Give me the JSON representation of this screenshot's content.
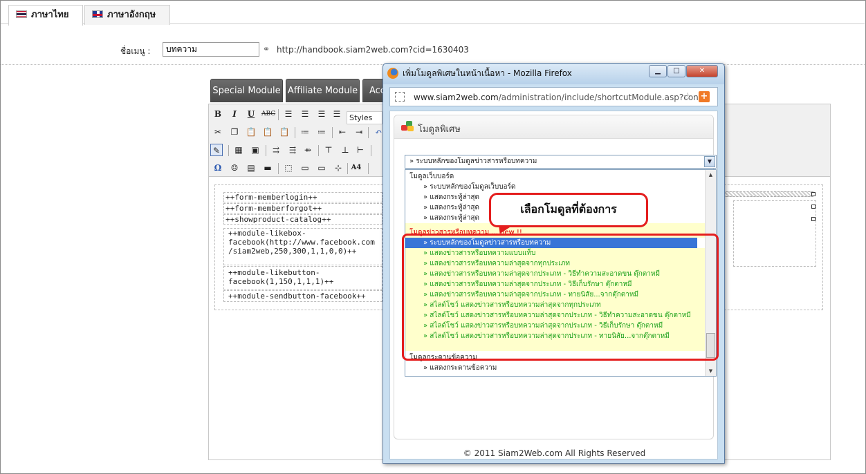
{
  "language_tabs": [
    {
      "label": "ภาษาไทย",
      "flag": "thai-flag"
    },
    {
      "label": "ภาษาอังกฤษ",
      "flag": "uk-flag"
    }
  ],
  "menu": {
    "label": "ชื่อเมนู :",
    "value": "บทความ",
    "url": "http://handbook.siam2web.com?cid=1630403"
  },
  "module_buttons": [
    "Special Module",
    "Affiliate Module",
    "Acc"
  ],
  "editor": {
    "styles_label": "Styles",
    "content_lines": [
      "++form-memberlogin++",
      "++form-memberforgot++",
      "++showproduct-catalog++",
      "++module-likebox-",
      "facebook(http://www.facebook.com",
      "/siam2web,250,300,1,1,0,0)++",
      "++module-likebutton-",
      "facebook(1,150,1,1,1)++",
      "++module-sendbutton-facebook++"
    ]
  },
  "popup": {
    "title": "เพิ่มโมดูลพิเศษในหน้าเนื้อหา - Mozilla Firefox",
    "url_host": "www.siam2web.com",
    "url_path": "/administration/include/shortcutModule.asp?conte",
    "panel_title": "โมดูลพิเศษ",
    "select_value": "» ระบบหลักของโมดูลข่าวสารหรือบทความ",
    "list": [
      {
        "text": "โมดูลเว็บบอร์ด",
        "kind": "grp"
      },
      {
        "text": "» ระบบหลักของโมดูลเว็บบอร์ด",
        "kind": "sub"
      },
      {
        "text": "» แสดงกระทู้ล่าสุด",
        "kind": "sub"
      },
      {
        "text": "» แสดงกระทู้ล่าสุด",
        "kind": "sub"
      },
      {
        "text": "» แสดงกระทู้ล่าสุด",
        "kind": "sub"
      },
      {
        "text": "โมดูลข่าวสารหรือบทความ ... new !!",
        "kind": "grp red hl"
      },
      {
        "text": "» ระบบหลักของโมดูลข่าวสารหรือบทความ",
        "kind": "sub selected"
      },
      {
        "text": "» แสดงข่าวสารหรือบทความแบบแท็บ",
        "kind": "sub green hl"
      },
      {
        "text": "» แสดงข่าวสารหรือบทความล่าสุดจากทุกประเภท",
        "kind": "sub green hl"
      },
      {
        "text": "» แสดงข่าวสารหรือบทความล่าสุดจากประเภท - วิธีทำความสะอาดขน ตุ๊กตาหมี",
        "kind": "sub green hl"
      },
      {
        "text": "» แสดงข่าวสารหรือบทความล่าสุดจากประเภท - วิธีเก็บรักษา ตุ๊กตาหมี",
        "kind": "sub green hl"
      },
      {
        "text": "» แสดงข่าวสารหรือบทความล่าสุดจากประเภท - ทายนิสัย...จากตุ๊กตาหมี",
        "kind": "sub green hl"
      },
      {
        "text": "» สไลด์โชว์ แสดงข่าวสารหรือบทความล่าสุดจากทุกประเภท",
        "kind": "sub green hl"
      },
      {
        "text": "» สไลด์โชว์ แสดงข่าวสารหรือบทความล่าสุดจากประเภท - วิธีทำความสะอาดขน ตุ๊กตาหมี",
        "kind": "sub green hl"
      },
      {
        "text": "» สไลด์โชว์ แสดงข่าวสารหรือบทความล่าสุดจากประเภท - วิธีเก็บรักษา ตุ๊กตาหมี",
        "kind": "sub green hl"
      },
      {
        "text": "» สไลด์โชว์ แสดงข่าวสารหรือบทความล่าสุดจากประเภท - ทายนิสัย...จากตุ๊กตาหมี",
        "kind": "sub green hl"
      },
      {
        "text": "",
        "kind": "grp hl"
      },
      {
        "text": "โมดูลกระดานข้อความ",
        "kind": "grp"
      },
      {
        "text": "» แสดงกระดานข้อความ",
        "kind": "sub"
      }
    ],
    "callout": "เลือกโมดูลที่ต้องการ",
    "footer": "© 2011 Siam2Web.com All Rights Reserved"
  },
  "colors": {
    "highlight_frame": "#e41e1e",
    "selected_row": "#3875d7",
    "new_items": "#1aa01a"
  }
}
